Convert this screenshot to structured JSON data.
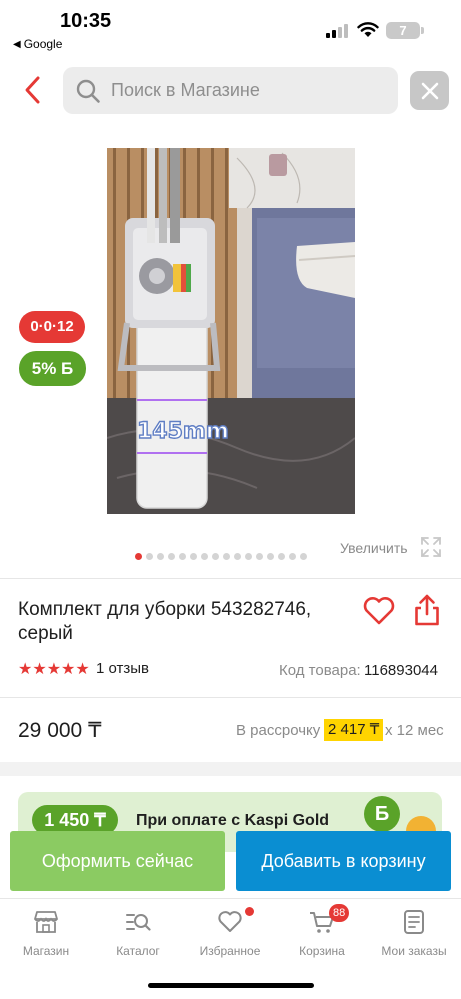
{
  "status_bar": {
    "time": "10:35",
    "back_app": "Google",
    "battery": "7"
  },
  "search": {
    "placeholder": "Поиск в Магазине"
  },
  "product": {
    "image_caption": "145mm",
    "badges": {
      "installment": "0·0·12",
      "bonus": "5% Б"
    },
    "gallery": {
      "total": 16,
      "active_index": 0,
      "zoom_label": "Увеличить"
    },
    "title": "Комплект для уборки 543282746, серый",
    "rating_stars": "★★★★★",
    "rating_value": 5,
    "reviews": "1 отзыв",
    "code_label": "Код товара:",
    "code_value": "116893044",
    "price": "29 000 ₸",
    "installment": {
      "label": "В рассрочку",
      "amount": "2 417 ₸",
      "term": "х 12 мес"
    }
  },
  "promo": {
    "amount": "1 450 ₸",
    "text": "При оплате с Kaspi Gold",
    "coin": "Б"
  },
  "actions": {
    "buy_now": "Оформить сейчас",
    "add_to_cart": "Добавить в корзину"
  },
  "tabbar": {
    "items": [
      {
        "label": "Магазин",
        "icon": "store-icon"
      },
      {
        "label": "Каталог",
        "icon": "catalog-search-icon"
      },
      {
        "label": "Избранное",
        "icon": "heart-icon"
      },
      {
        "label": "Корзина",
        "icon": "cart-icon",
        "badge": "88"
      },
      {
        "label": "Мои заказы",
        "icon": "orders-icon"
      }
    ]
  },
  "colors": {
    "accent_red": "#e53935",
    "bonus_green": "#5aa329",
    "buy_green": "#8bcb62",
    "cart_blue": "#0a8ed2",
    "installment_yellow": "#ffd400"
  }
}
